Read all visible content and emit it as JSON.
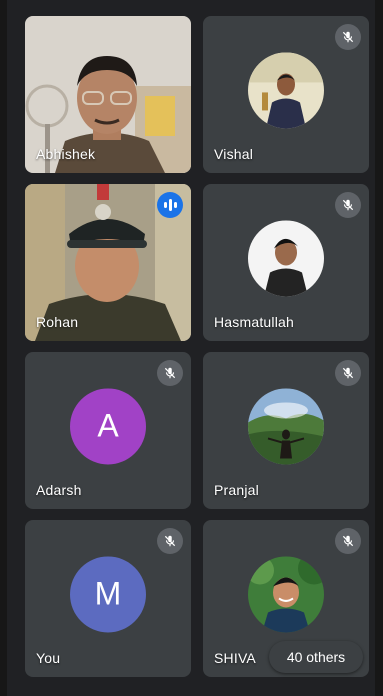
{
  "participants": [
    {
      "name": "Abhishek",
      "state": "speaking-video"
    },
    {
      "name": "Vishal",
      "state": "muted"
    },
    {
      "name": "Rohan",
      "state": "speaking"
    },
    {
      "name": "Hasmatullah",
      "state": "muted"
    },
    {
      "name": "Adarsh",
      "state": "muted",
      "initial": "A",
      "avatar_color": "#a142c6"
    },
    {
      "name": "Pranjal",
      "state": "muted"
    },
    {
      "name": "You",
      "state": "muted",
      "initial": "M",
      "avatar_color": "#5c6bc0"
    },
    {
      "name": "SHIVA",
      "state": "muted"
    }
  ],
  "others_label": "40 others",
  "colors": {
    "background": "#202124",
    "tile": "#3c4043",
    "speaking_indicator": "#1a73e8",
    "mute_badge": "#5f6368"
  },
  "icons": {
    "muted": "mic-off-icon",
    "speaking": "audio-level-icon"
  }
}
